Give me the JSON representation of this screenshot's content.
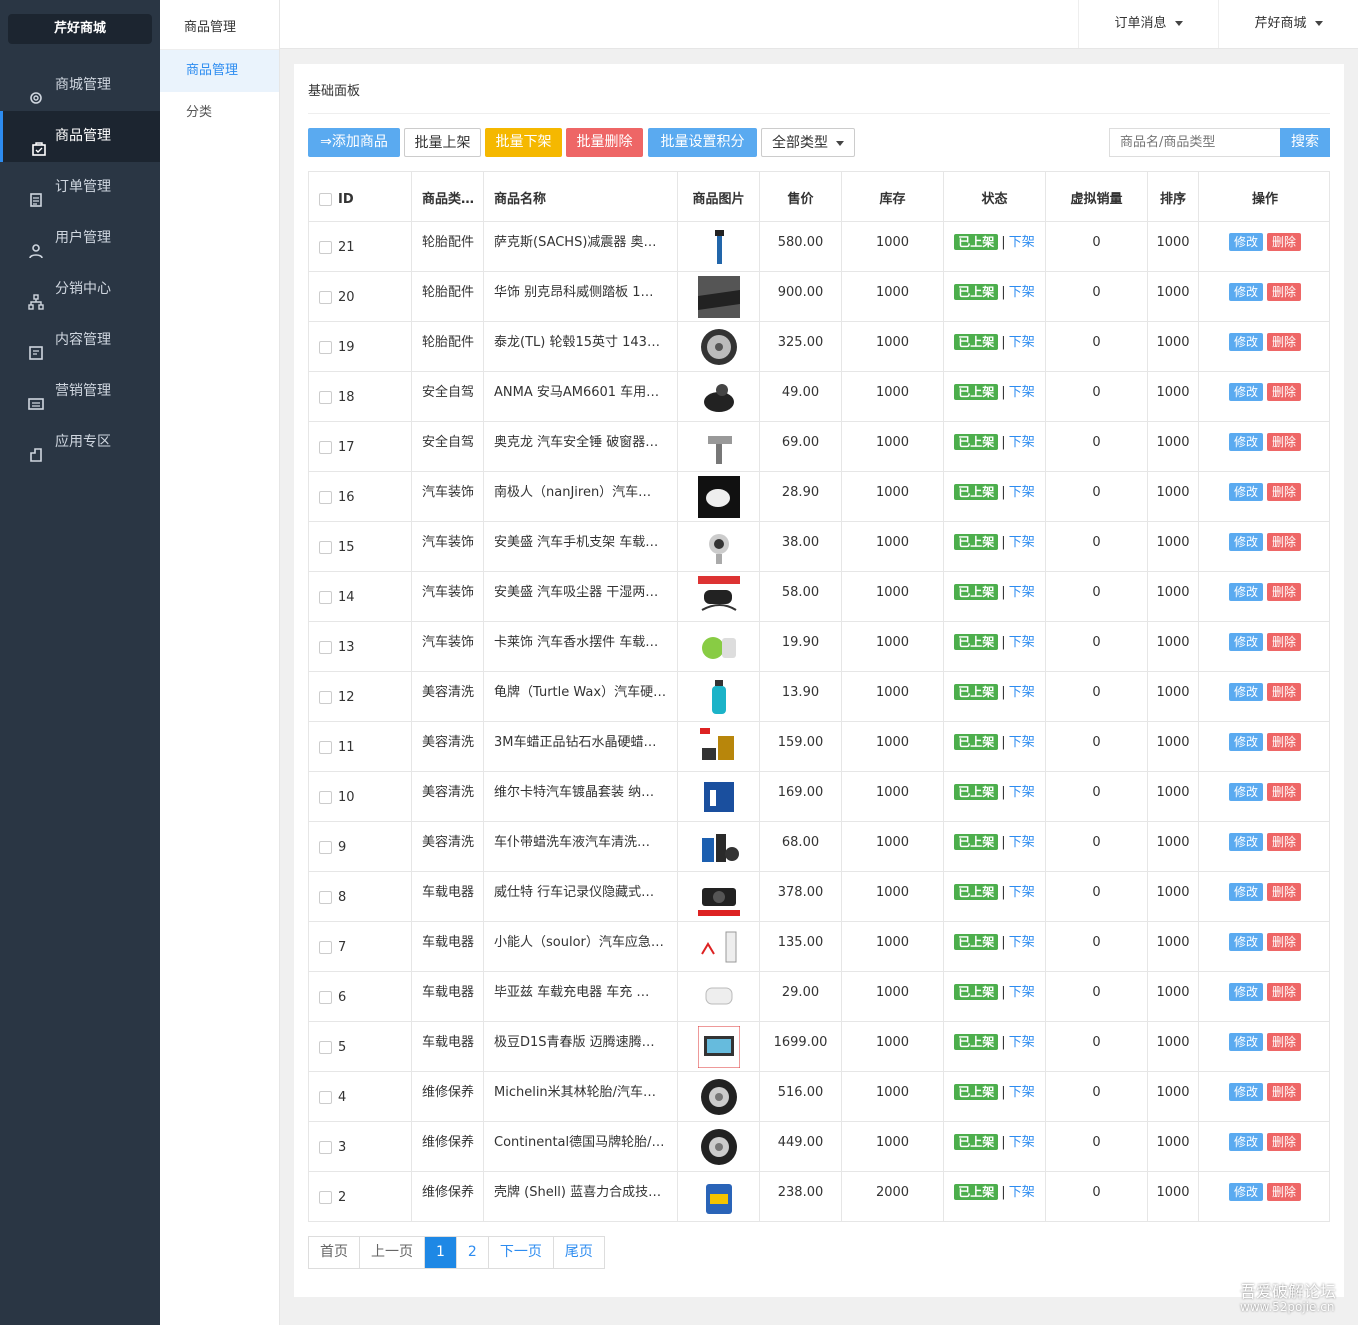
{
  "app": {
    "brand": "芹好商城"
  },
  "sidebar": {
    "items": [
      {
        "label": "商城管理",
        "icon": "gear-icon"
      },
      {
        "label": "商品管理",
        "icon": "bag-icon"
      },
      {
        "label": "订单管理",
        "icon": "order-icon"
      },
      {
        "label": "用户管理",
        "icon": "user-icon"
      },
      {
        "label": "分销中心",
        "icon": "network-icon"
      },
      {
        "label": "内容管理",
        "icon": "content-icon"
      },
      {
        "label": "营销管理",
        "icon": "ticket-icon"
      },
      {
        "label": "应用专区",
        "icon": "apps-icon"
      }
    ],
    "active": "商品管理"
  },
  "subnav": {
    "title": "商品管理",
    "items": [
      {
        "label": "商品管理"
      },
      {
        "label": "分类"
      }
    ]
  },
  "topbar": {
    "orders_label": "订单消息",
    "shop_label": "芹好商城"
  },
  "panel": {
    "title": "基础面板"
  },
  "toolbar": {
    "add": "添加商品",
    "batch_on": "批量上架",
    "batch_off": "批量下架",
    "batch_delete": "批量删除",
    "batch_points": "批量设置积分",
    "type_select": "全部类型",
    "search_placeholder": "商品名/商品类型",
    "search": "搜索"
  },
  "colors": {
    "primary": "#5aaaf0",
    "warning": "#f5b800",
    "danger": "#e66",
    "success": "#4cae4c",
    "sidebar": "#2a3644"
  },
  "table": {
    "headers": [
      "ID",
      "商品类…",
      "商品名称",
      "商品图片",
      "售价",
      "库存",
      "状态",
      "虚拟销量",
      "排序",
      "操作"
    ],
    "status_on": "已上架",
    "status_off": "下架",
    "edit": "修改",
    "delete": "删除",
    "rows": [
      {
        "id": "21",
        "category": "轮胎配件",
        "name": "萨克斯(SACHS)减震器 奥…",
        "price": "580.00",
        "stock": "1000",
        "sales": "0",
        "sort": "1000",
        "img": "shock-absorber"
      },
      {
        "id": "20",
        "category": "轮胎配件",
        "name": "华饰 别克昂科威侧踏板 1…",
        "price": "900.00",
        "stock": "1000",
        "sales": "0",
        "sort": "1000",
        "img": "side-step"
      },
      {
        "id": "19",
        "category": "轮胎配件",
        "name": "泰龙(TL) 轮毂15英寸 143…",
        "price": "325.00",
        "stock": "1000",
        "sales": "0",
        "sort": "1000",
        "img": "wheel-rim"
      },
      {
        "id": "18",
        "category": "安全自驾",
        "name": "ANMA 安马AM6601 车用…",
        "price": "49.00",
        "stock": "1000",
        "sales": "0",
        "sort": "1000",
        "img": "pump"
      },
      {
        "id": "17",
        "category": "安全自驾",
        "name": "奥克龙 汽车安全锤 破窗器…",
        "price": "69.00",
        "stock": "1000",
        "sales": "0",
        "sort": "1000",
        "img": "hammer"
      },
      {
        "id": "16",
        "category": "汽车装饰",
        "name": "南极人（nanJiren）汽车…",
        "price": "28.90",
        "stock": "1000",
        "sales": "0",
        "sort": "1000",
        "img": "cushion"
      },
      {
        "id": "15",
        "category": "汽车装饰",
        "name": "安美盛 汽车手机支架 车载…",
        "price": "38.00",
        "stock": "1000",
        "sales": "0",
        "sort": "1000",
        "img": "phone-holder"
      },
      {
        "id": "14",
        "category": "汽车装饰",
        "name": "安美盛 汽车吸尘器 干湿两…",
        "price": "58.00",
        "stock": "1000",
        "sales": "0",
        "sort": "1000",
        "img": "vacuum"
      },
      {
        "id": "13",
        "category": "汽车装饰",
        "name": "卡莱饰 汽车香水摆件 车载…",
        "price": "19.90",
        "stock": "1000",
        "sales": "0",
        "sort": "1000",
        "img": "perfume"
      },
      {
        "id": "12",
        "category": "美容清洗",
        "name": "龟牌（Turtle Wax）汽车硬…",
        "price": "13.90",
        "stock": "1000",
        "sales": "0",
        "sort": "1000",
        "img": "wax-bottle"
      },
      {
        "id": "11",
        "category": "美容清洗",
        "name": "3M车蜡正品钻石水晶硬蜡…",
        "price": "159.00",
        "stock": "1000",
        "sales": "0",
        "sort": "1000",
        "img": "car-wax"
      },
      {
        "id": "10",
        "category": "美容清洗",
        "name": "维尔卡特汽车镀晶套装 纳…",
        "price": "169.00",
        "stock": "1000",
        "sales": "0",
        "sort": "1000",
        "img": "coating-kit"
      },
      {
        "id": "9",
        "category": "美容清洗",
        "name": "车仆带蜡洗车液汽车清洗…",
        "price": "68.00",
        "stock": "1000",
        "sales": "0",
        "sort": "1000",
        "img": "wash-liquid"
      },
      {
        "id": "8",
        "category": "车载电器",
        "name": "威仕特 行车记录仪隐藏式…",
        "price": "378.00",
        "stock": "1000",
        "sales": "0",
        "sort": "1000",
        "img": "dashcam"
      },
      {
        "id": "7",
        "category": "车载电器",
        "name": "小能人（soulor）汽车应急…",
        "price": "135.00",
        "stock": "1000",
        "sales": "0",
        "sort": "1000",
        "img": "jump-starter"
      },
      {
        "id": "6",
        "category": "车载电器",
        "name": "毕亚兹 车载充电器 车充 …",
        "price": "29.00",
        "stock": "1000",
        "sales": "0",
        "sort": "1000",
        "img": "charger"
      },
      {
        "id": "5",
        "category": "车载电器",
        "name": "极豆D1S青春版 迈腾速腾…",
        "price": "1699.00",
        "stock": "1000",
        "sales": "0",
        "sort": "1000",
        "img": "navigator"
      },
      {
        "id": "4",
        "category": "维修保养",
        "name": "Michelin米其林轮胎/汽车…",
        "price": "516.00",
        "stock": "1000",
        "sales": "0",
        "sort": "1000",
        "img": "tire"
      },
      {
        "id": "3",
        "category": "维修保养",
        "name": "Continental德国马牌轮胎/…",
        "price": "449.00",
        "stock": "1000",
        "sales": "0",
        "sort": "1000",
        "img": "tire"
      },
      {
        "id": "2",
        "category": "维修保养",
        "name": "壳牌 (Shell) 蓝喜力合成技…",
        "price": "238.00",
        "stock": "2000",
        "sales": "0",
        "sort": "1000",
        "img": "oil-can"
      }
    ]
  },
  "pagination": {
    "first": "首页",
    "prev": "上一页",
    "pages": [
      "1",
      "2"
    ],
    "current": "1",
    "next": "下一页",
    "last": "尾页"
  },
  "watermark": {
    "line1": "吾爱破解论坛",
    "line2": "www.52pojie.cn"
  }
}
